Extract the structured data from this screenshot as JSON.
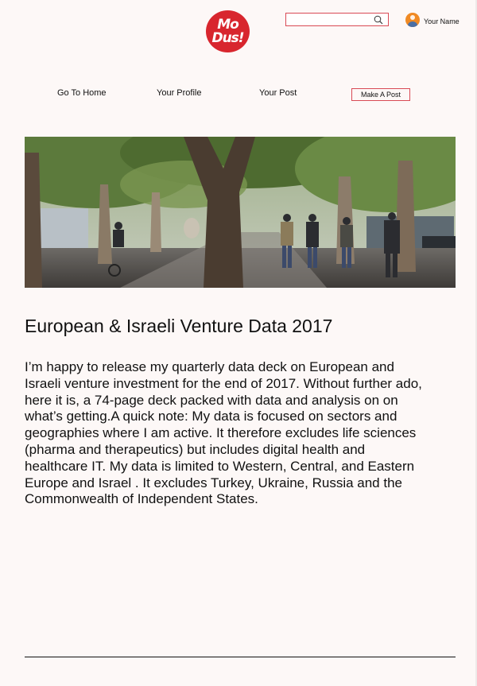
{
  "header": {
    "logo_line1": "Mo",
    "logo_line2": "Dus!",
    "search_placeholder": "",
    "user_name": "Your Name"
  },
  "nav": {
    "home": "Go To Home",
    "profile": "Your Profile",
    "post": "Your Post",
    "make_post": "Make A Post"
  },
  "article": {
    "title": "European & Israeli Venture Data 2017",
    "body": "I’m happy to release my quarterly data deck on European and Israeli venture investment for the end of 2017. Without further ado, here it is, a 74-page deck packed with data and analysis on on what’s getting.A quick note: My data is focused on sectors and geographies where I am active. It therefore excludes life sciences (pharma and therapeutics) but includes digital health and healthcare IT. My data is limited to Western, Central, and Eastern Europe and Israel . It excludes Turkey, Ukraine, Russia and the Commonwealth of Independent States."
  },
  "colors": {
    "background": "#fdf8f7",
    "brand_red": "#d8262e",
    "outline_red": "#d94a55"
  },
  "icons": [
    "search-icon",
    "avatar-icon"
  ]
}
